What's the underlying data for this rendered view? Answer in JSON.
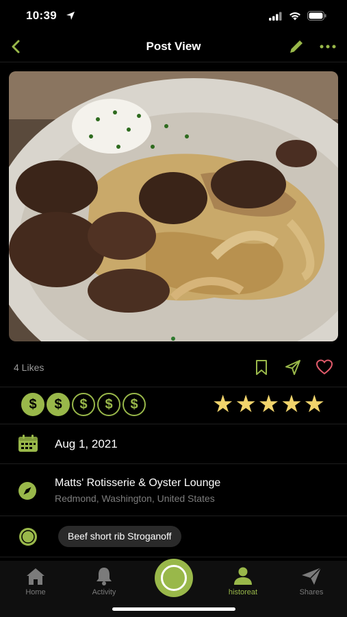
{
  "status": {
    "time": "10:39"
  },
  "nav": {
    "title": "Post View"
  },
  "post": {
    "likes": "4 Likes",
    "price_level": 2,
    "price_max": 5,
    "price_symbol": "$",
    "rating": 5,
    "rating_max": 5,
    "date": "Aug 1, 2021",
    "place_name": "Matts' Rotisserie & Oyster Lounge",
    "place_location": "Redmond, Washington, United States",
    "dish_tag": "Beef short rib Stroganoff"
  },
  "tabs": [
    {
      "label": "Home",
      "icon": "home-icon"
    },
    {
      "label": "Activity",
      "icon": "bell-icon"
    },
    {
      "label": "",
      "icon": "capture-icon"
    },
    {
      "label": "historeat",
      "icon": "user-icon"
    },
    {
      "label": "Shares",
      "icon": "paper-plane-icon"
    }
  ],
  "colors": {
    "accent": "#99b84a",
    "star": "#f1d46c",
    "heart": "#e05a6a",
    "background": "#000000"
  }
}
